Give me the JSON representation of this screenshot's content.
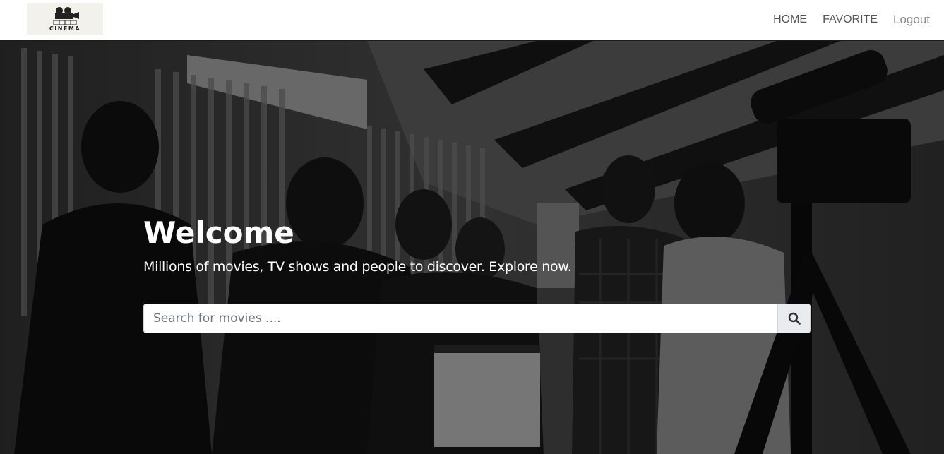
{
  "logo": {
    "text": "CINEMA",
    "icon": "film-camera-icon"
  },
  "nav": {
    "home": "HOME",
    "favorite": "FAVORITE",
    "logout": "Logout"
  },
  "hero": {
    "title": "Welcome",
    "subtitle": "Millions of movies, TV shows and people to discover. Explore now.",
    "background": "film-crew-photo"
  },
  "search": {
    "placeholder": "Search for movies ....",
    "value": "",
    "button_icon": "search-icon"
  },
  "colors": {
    "nav_border": "#1a1a1a",
    "hero_text": "#ffffff",
    "search_button_bg": "#e9ecef"
  }
}
